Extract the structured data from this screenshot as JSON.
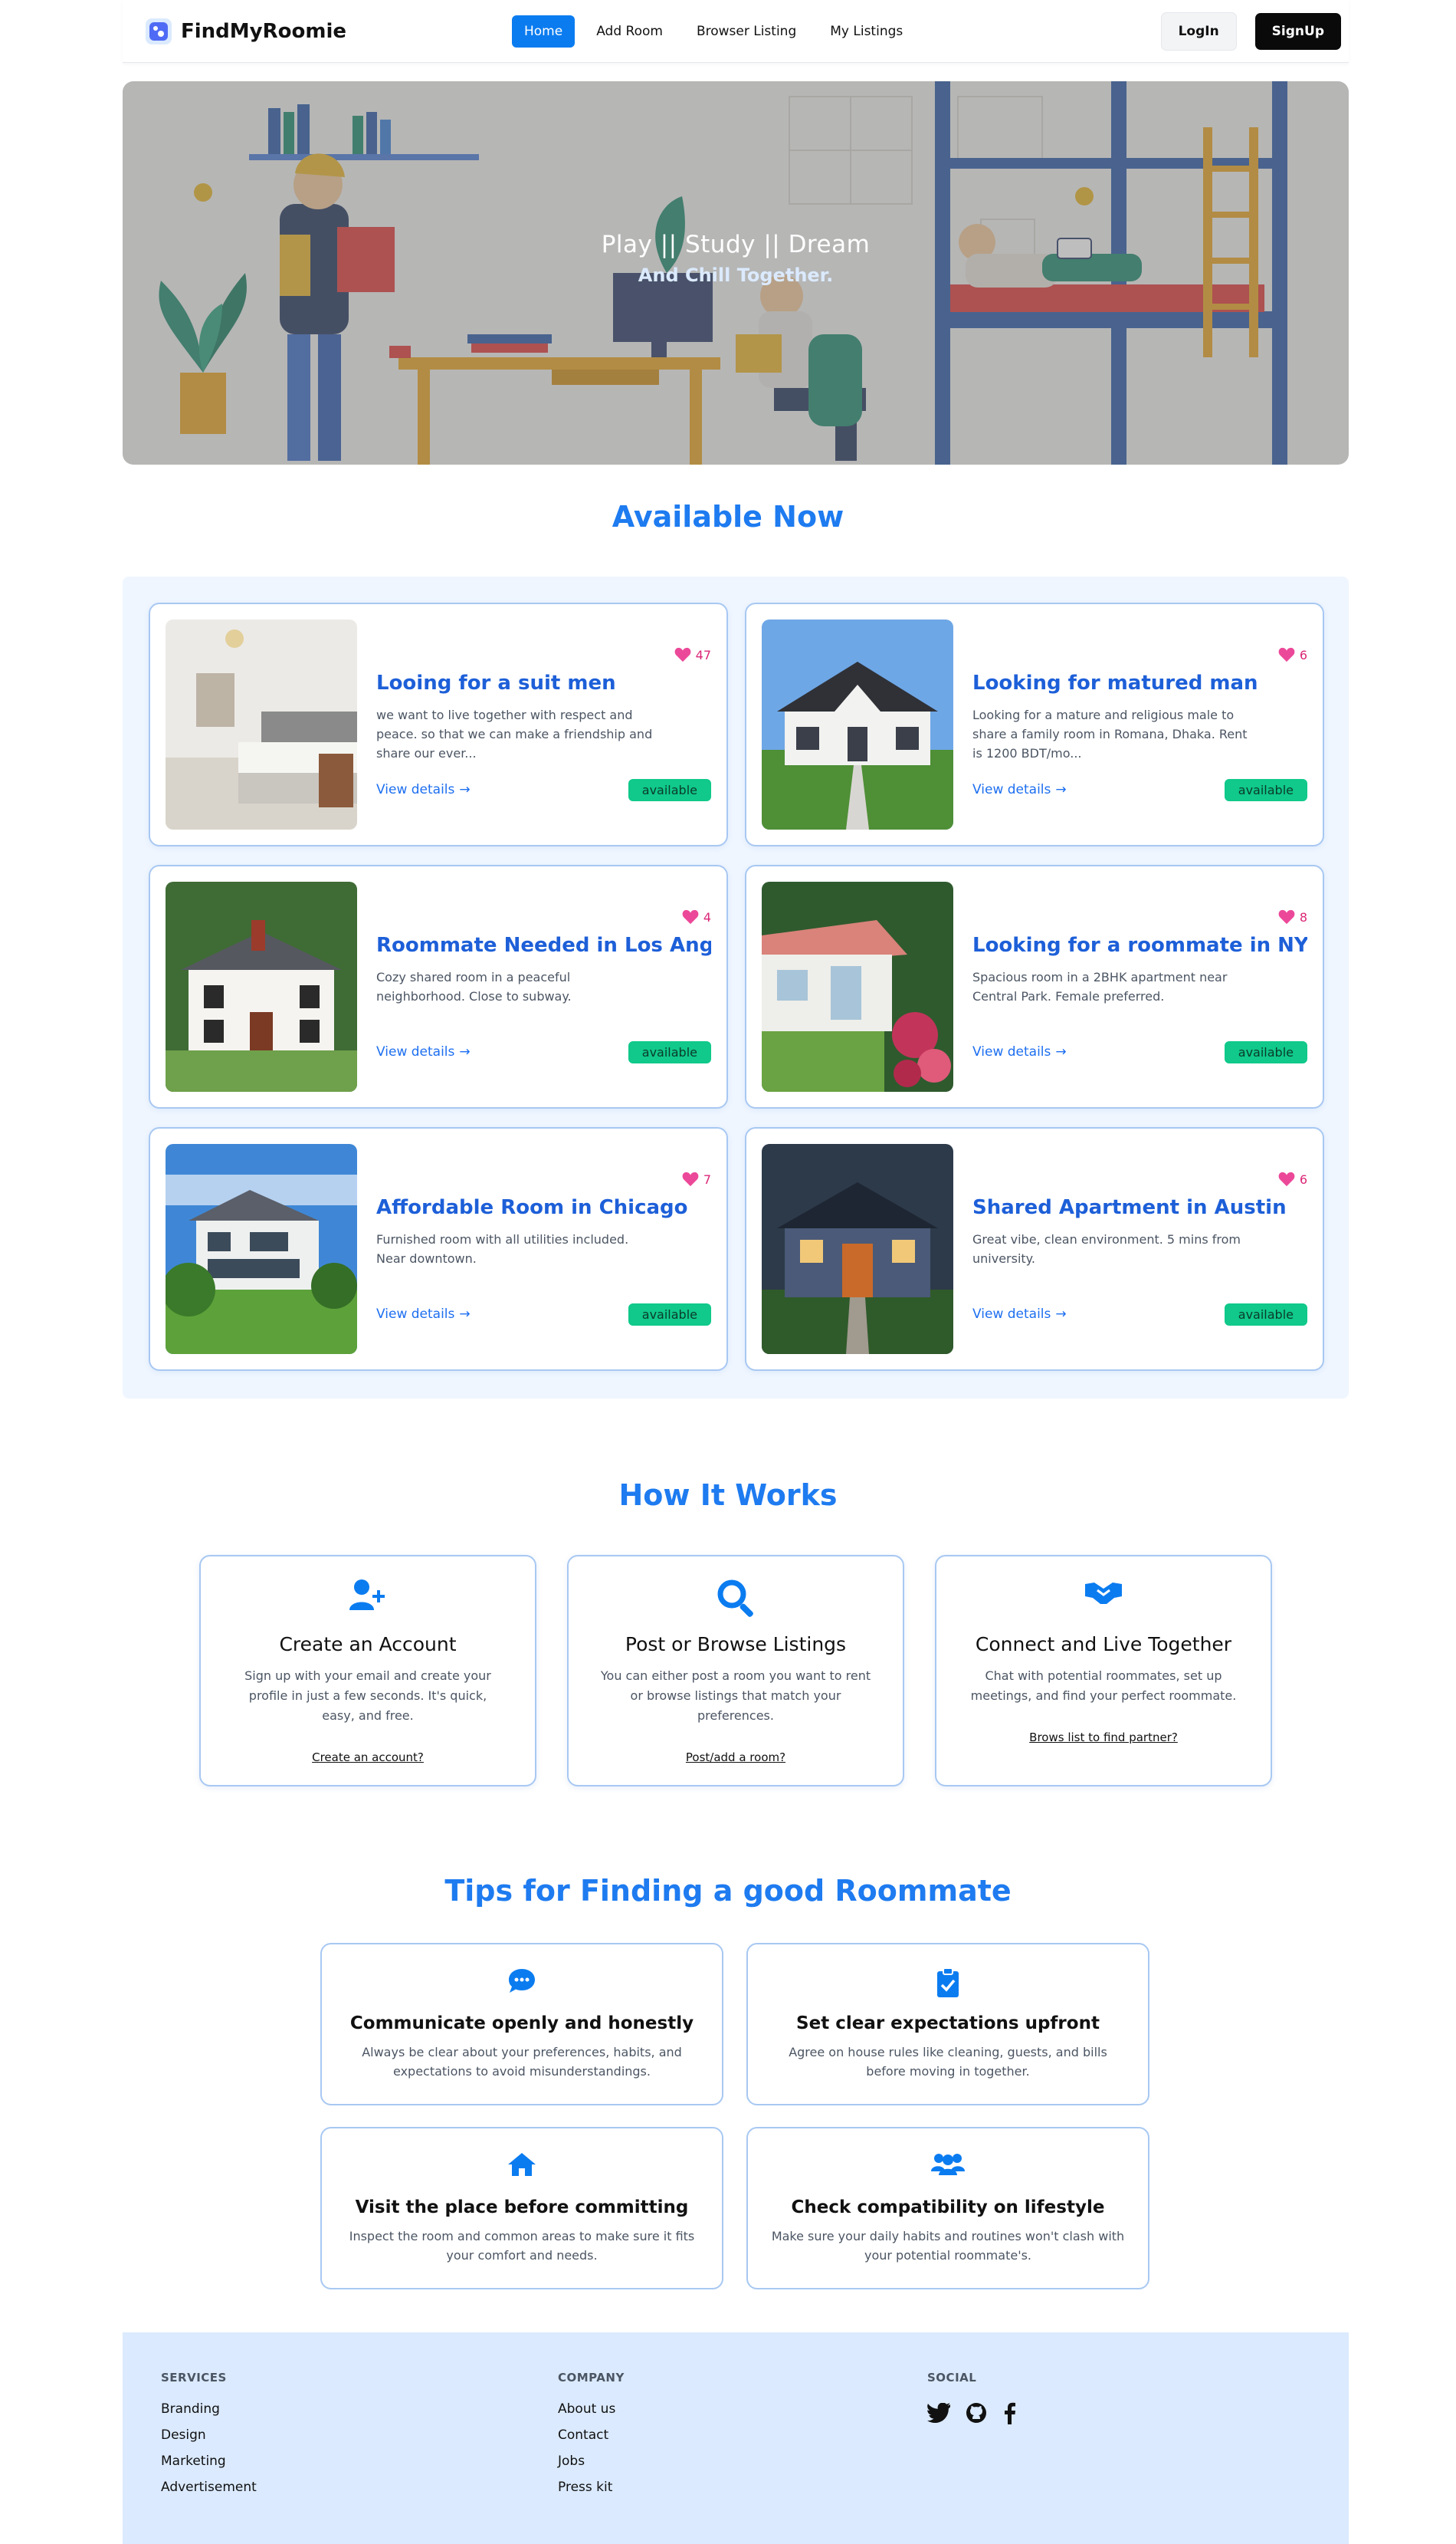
{
  "app": {
    "brand": "FindMyRoomie",
    "accent": "#0b7cf0"
  },
  "nav": {
    "links": [
      {
        "label": "Home",
        "active": true
      },
      {
        "label": "Add Room",
        "active": false
      },
      {
        "label": "Browser Listing",
        "active": false
      },
      {
        "label": "My Listings",
        "active": false
      }
    ],
    "login": "LogIn",
    "signup": "SignUp"
  },
  "hero": {
    "title": "Play || Study || Dream",
    "subtitle": "And Chill Together."
  },
  "available": {
    "heading": "Available Now",
    "details_label": "View details",
    "cards": [
      {
        "title": "Looing for a suit men",
        "likes": "47",
        "desc": "we want to live together with respect and peace. so that we can make a friendship and share our ever...",
        "status": "available",
        "photo": "bedroom"
      },
      {
        "title": "Looking for matured man",
        "likes": "6",
        "desc": "Looking for a mature and religious male to share a family room in Romana, Dhaka. Rent is 1200 BDT/mo...",
        "status": "available",
        "photo": "white-cottage"
      },
      {
        "title": "Roommate Needed in Los Angeles",
        "likes": "4",
        "desc": "Cozy shared room in a peaceful neighborhood. Close to subway.",
        "status": "available",
        "photo": "colonial-house"
      },
      {
        "title": "Looking for a roommate in NYC",
        "likes": "8",
        "desc": "Spacious room in a 2BHK apartment near Central Park. Female preferred.",
        "status": "available",
        "photo": "garden-cottage"
      },
      {
        "title": "Affordable Room in Chicago",
        "likes": "7",
        "desc": "Furnished room with all utilities included. Near downtown.",
        "status": "available",
        "photo": "modern-house"
      },
      {
        "title": "Shared Apartment in Austin",
        "likes": "6",
        "desc": "Great vibe, clean environment. 5 mins from university.",
        "status": "available",
        "photo": "evening-house"
      }
    ]
  },
  "how": {
    "heading": "How It Works",
    "steps": [
      {
        "icon": "user-plus-icon",
        "title": "Create an Account",
        "desc": "Sign up with your email and create your profile in just a few seconds. It's quick, easy, and free.",
        "link": "Create an account?"
      },
      {
        "icon": "search-icon",
        "title": "Post or Browse Listings",
        "desc": "You can either post a room you want to rent or browse listings that match your preferences.",
        "link": "Post/add a room?"
      },
      {
        "icon": "handshake-icon",
        "title": "Connect and Live Together",
        "desc": "Chat with potential roommates, set up meetings, and find your perfect roommate.",
        "link": "Brows list to find partner?"
      }
    ]
  },
  "tips": {
    "heading": "Tips for Finding a good Roommate",
    "items": [
      {
        "icon": "chat-bubble-icon",
        "title": "Communicate openly and honestly",
        "desc": "Always be clear about your preferences, habits, and expectations to avoid misunderstandings."
      },
      {
        "icon": "clipboard-check-icon",
        "title": "Set clear expectations upfront",
        "desc": "Agree on house rules like cleaning, guests, and bills before moving in together."
      },
      {
        "icon": "home-icon",
        "title": "Visit the place before committing",
        "desc": "Inspect the room and common areas to make sure it fits your comfort and needs."
      },
      {
        "icon": "users-icon",
        "title": "Check compatibility on lifestyle",
        "desc": "Make sure your daily habits and routines won't clash with your potential roommate's."
      }
    ]
  },
  "footer": {
    "services": {
      "heading": "SERVICES",
      "items": [
        "Branding",
        "Design",
        "Marketing",
        "Advertisement"
      ]
    },
    "company": {
      "heading": "COMPANY",
      "items": [
        "About us",
        "Contact",
        "Jobs",
        "Press kit"
      ]
    },
    "social": {
      "heading": "SOCIAL",
      "icons": [
        "twitter-icon",
        "github-icon",
        "facebook-icon"
      ]
    }
  }
}
